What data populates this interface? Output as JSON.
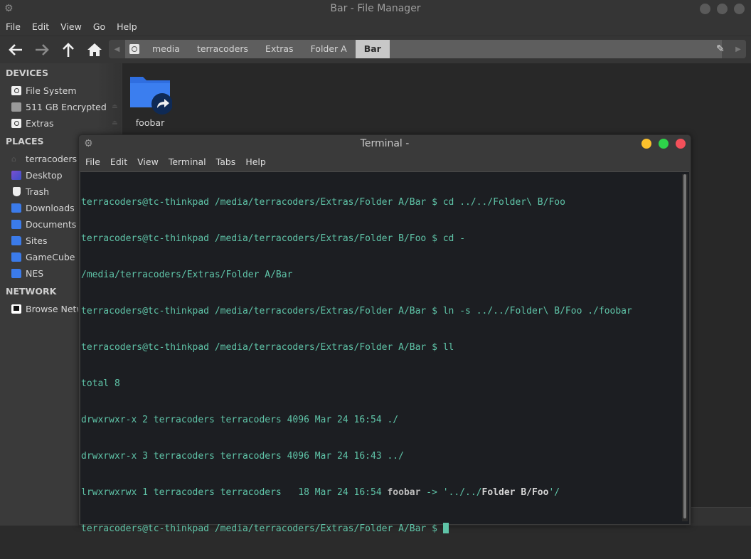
{
  "file_manager": {
    "title": "Bar - File Manager",
    "menu": [
      "File",
      "Edit",
      "View",
      "Go",
      "Help"
    ],
    "path": [
      "media",
      "terracoders",
      "Extras",
      "Folder A",
      "Bar"
    ],
    "active_crumb": "Bar",
    "sidebar": {
      "devices_heading": "DEVICES",
      "devices": [
        {
          "label": "File System",
          "icon": "drive-icon"
        },
        {
          "label": "511 GB Encrypted",
          "icon": "encrypted-drive-icon"
        },
        {
          "label": "Extras",
          "icon": "usb-drive-icon"
        }
      ],
      "places_heading": "PLACES",
      "places": [
        {
          "label": "terracoders",
          "icon": "home-icon"
        },
        {
          "label": "Desktop",
          "icon": "desktop-icon"
        },
        {
          "label": "Trash",
          "icon": "trash-icon"
        },
        {
          "label": "Downloads",
          "icon": "downloads-folder-icon"
        },
        {
          "label": "Documents",
          "icon": "documents-folder-icon"
        },
        {
          "label": "Sites",
          "icon": "folder-icon"
        },
        {
          "label": "GameCube",
          "icon": "folder-icon"
        },
        {
          "label": "NES",
          "icon": "folder-icon"
        }
      ],
      "network_heading": "NETWORK",
      "network": [
        {
          "label": "Browse Network",
          "icon": "network-icon"
        }
      ]
    },
    "files": [
      {
        "name": "foobar",
        "type": "symlink-folder"
      }
    ]
  },
  "terminal": {
    "title": "Terminal -",
    "menu": [
      "File",
      "Edit",
      "View",
      "Terminal",
      "Tabs",
      "Help"
    ],
    "lines": [
      "terracoders@tc-thinkpad /media/terracoders/Extras/Folder A/Bar $ cd ../../Folder\\ B/Foo",
      "terracoders@tc-thinkpad /media/terracoders/Extras/Folder B/Foo $ cd -",
      "/media/terracoders/Extras/Folder A/Bar",
      "terracoders@tc-thinkpad /media/terracoders/Extras/Folder A/Bar $ ln -s ../../Folder\\ B/Foo ./foobar",
      "terracoders@tc-thinkpad /media/terracoders/Extras/Folder A/Bar $ ll",
      "total 8",
      "drwxrwxr-x 2 terracoders terracoders 4096 Mar 24 16:54 ./",
      "drwxrwxr-x 3 terracoders terracoders 4096 Mar 24 16:43 ../"
    ],
    "symlink_line": {
      "prefix": "lrwxrwxrwx 1 terracoders terracoders   18 Mar 24 16:54 ",
      "name": "foobar",
      "arrow": " -> '../../",
      "target": "Folder B/Foo",
      "suffix": "'/"
    },
    "prompt": "terracoders@tc-thinkpad /media/terracoders/Extras/Folder A/Bar $ ",
    "colors": {
      "text": "#5fc4a8",
      "background": "#1c1e22",
      "minimize": "#fcc12c",
      "maximize": "#2ed34a",
      "close": "#f3505a"
    }
  }
}
